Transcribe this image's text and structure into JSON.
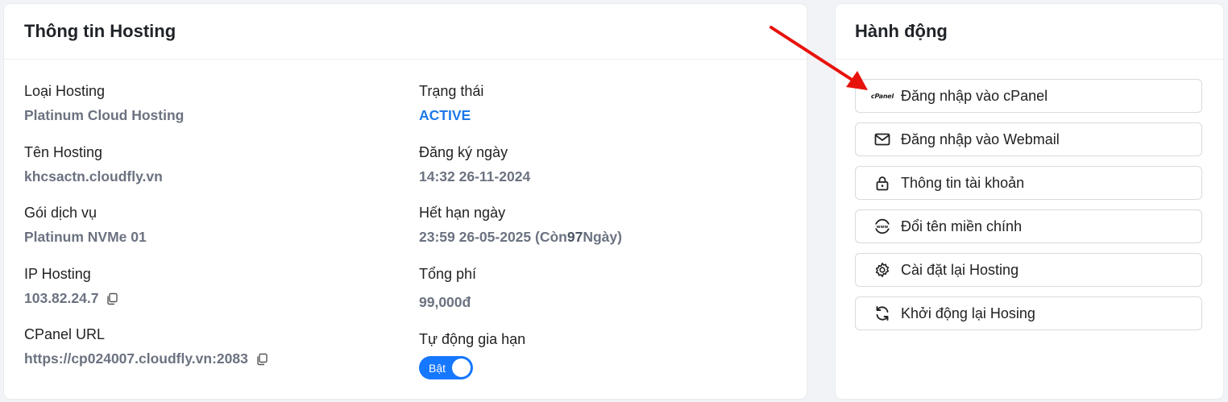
{
  "info": {
    "title": "Thông tin Hosting",
    "left": [
      {
        "label": "Loại Hosting",
        "value": "Platinum Cloud Hosting"
      },
      {
        "label": "Tên Hosting",
        "value": "khcsactn.cloudfly.vn"
      },
      {
        "label": "Gói dịch vụ",
        "value": "Platinum NVMe 01"
      },
      {
        "label": "IP Hosting",
        "value": "103.82.24.7"
      },
      {
        "label": "CPanel URL",
        "value": "https://cp024007.cloudfly.vn:2083"
      }
    ],
    "right": {
      "status": {
        "label": "Trạng thái",
        "value": "ACTIVE"
      },
      "registered": {
        "label": "Đăng ký ngày",
        "value": "14:32 26-11-2024"
      },
      "expires": {
        "label": "Hết hạn ngày",
        "value": "23:59 26-05-2025",
        "remaining_prefix": "(Còn ",
        "remaining_days": "97",
        "remaining_suffix": " Ngày)"
      },
      "total": {
        "label": "Tổng phí",
        "value": "99,000đ"
      },
      "auto_renew": {
        "label": "Tự động gia hạn",
        "toggle_label": "Bật",
        "on": true
      }
    }
  },
  "actions": {
    "title": "Hành động",
    "items": [
      {
        "label": "Đăng nhập vào cPanel",
        "icon": "cpanel-logo",
        "icon_text": "cPanel"
      },
      {
        "label": "Đăng nhập vào Webmail",
        "icon": "mail-icon"
      },
      {
        "label": "Thông tin tài khoản",
        "icon": "lock-icon"
      },
      {
        "label": "Đổi tên miền chính",
        "icon": "www-globe-icon"
      },
      {
        "label": "Cài đặt lại Hosting",
        "icon": "gear-icon"
      },
      {
        "label": "Khởi động lại Hosing",
        "icon": "refresh-icon"
      }
    ]
  },
  "colors": {
    "accent": "#1677ff",
    "active": "#1e7ae8",
    "arrow": "#e8120c"
  }
}
